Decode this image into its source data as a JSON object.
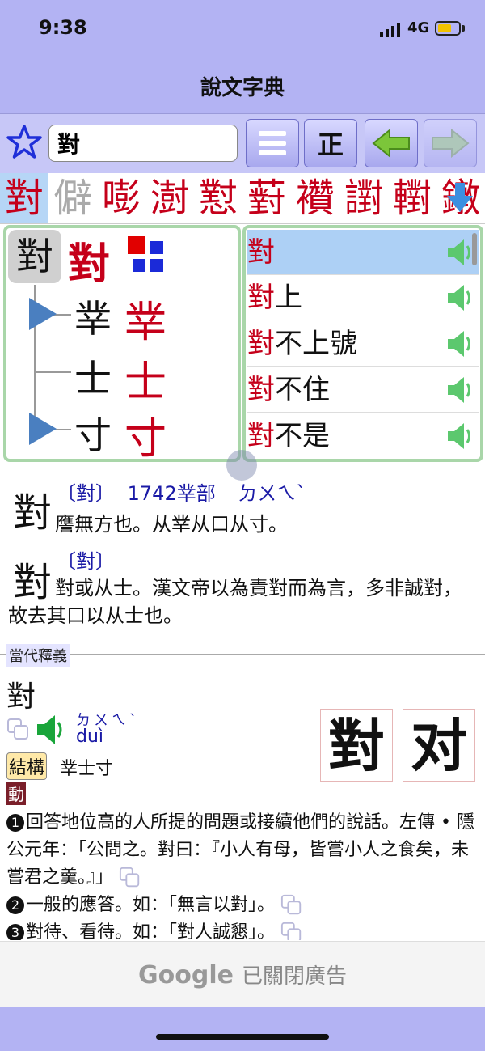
{
  "status": {
    "time": "9:38",
    "network": "4G"
  },
  "nav": {
    "title": "說文字典"
  },
  "toolbar": {
    "search_value": "對",
    "zheng_label": "正",
    "menu_icon": "hamburger-icon",
    "back_icon": "green-left-arrow-icon",
    "forward_icon": "green-right-arrow-icon"
  },
  "strip": {
    "chars": [
      "對",
      "僻",
      "嘭",
      "澍",
      "懟",
      "薱",
      "襸",
      "譵",
      "轛",
      "鐓"
    ]
  },
  "tree": {
    "seal": "對",
    "char": "對",
    "components": [
      {
        "seal": "丵",
        "char": "丵"
      },
      {
        "seal": "士",
        "char": "士"
      },
      {
        "seal": "寸",
        "char": "寸"
      }
    ]
  },
  "words": [
    {
      "hl": "對",
      "rest": ""
    },
    {
      "hl": "對",
      "rest": "上"
    },
    {
      "hl": "對",
      "rest": "不上號"
    },
    {
      "hl": "對",
      "rest": "不住"
    },
    {
      "hl": "對",
      "rest": "不是"
    }
  ],
  "shuowen": {
    "entry1": {
      "seal": "對",
      "heading": "〔對〕",
      "number_radical": "1742丵部",
      "bopomofo": "ㄉㄨㄟˋ",
      "text": "譍無方也。从丵从口从寸。"
    },
    "entry2": {
      "seal": "對",
      "heading": "〔對〕",
      "text": "對或从士。漢文帝以為責對而為言，多非誠對，故去其口以从士也。"
    }
  },
  "modern": {
    "section_label": "當代釋義",
    "headchar": "對",
    "bopomofo": "ㄉㄨㄟˋ",
    "pinyin": "duì",
    "trad": "對",
    "simp": "对",
    "structure_label": "結構",
    "structure_value": "丵士寸",
    "pos": "動",
    "defs": [
      {
        "num": "1",
        "text": "回答地位高的人所提的問題或接續他們的說話。左傳 • 隱公元年：「公問之。對曰：『小人有母，皆嘗小人之食矣，未嘗君之羹。』」"
      },
      {
        "num": "2",
        "text": "一般的應答。如：「無言以對」。"
      },
      {
        "num": "3",
        "text": "對待、看待。如：「對人誠懇」。"
      }
    ]
  },
  "ad": {
    "google": "Google",
    "text": "已關閉廣告"
  },
  "colors": {
    "accent_red": "#c5001a",
    "nav_bg": "#b3b3f3",
    "panel_border": "#a9d6a9",
    "selected_row": "#add0f5"
  }
}
